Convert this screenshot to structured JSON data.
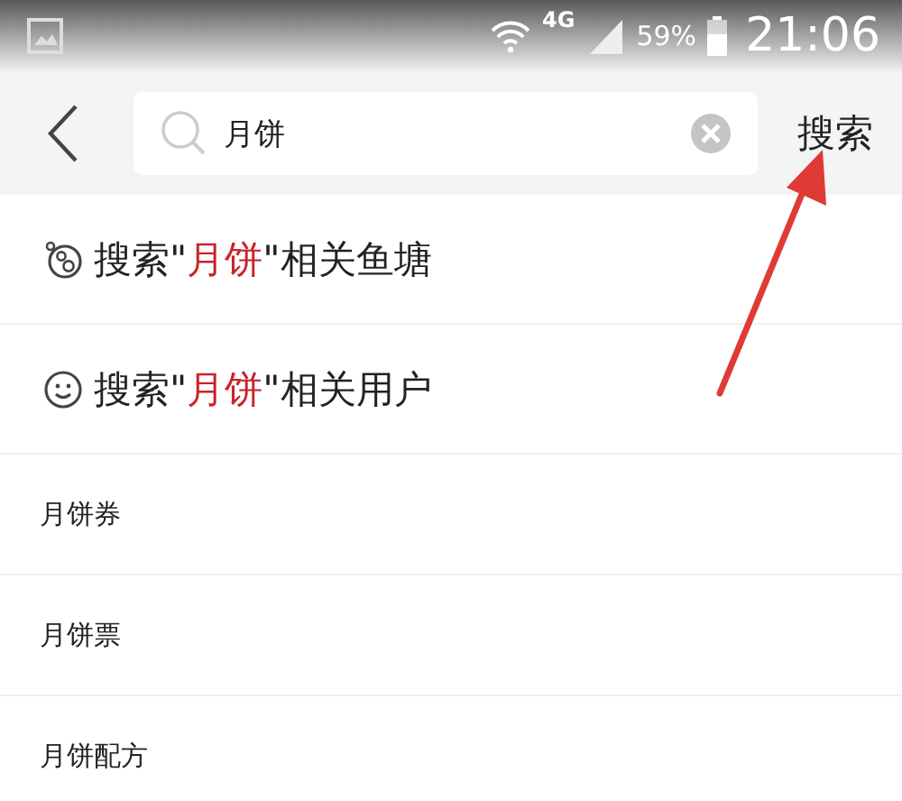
{
  "status_bar": {
    "network": "4G",
    "battery": "59%",
    "time": "21:06"
  },
  "search_bar": {
    "value": "月饼",
    "submit": "搜索"
  },
  "scoped_searches": [
    {
      "kind": "pond",
      "prefix": "搜索\"",
      "keyword": "月饼",
      "suffix": "\"相关鱼塘"
    },
    {
      "kind": "user",
      "prefix": "搜索\"",
      "keyword": "月饼",
      "suffix": "\"相关用户"
    }
  ],
  "suggestions": [
    "月饼券",
    "月饼票",
    "月饼配方"
  ]
}
